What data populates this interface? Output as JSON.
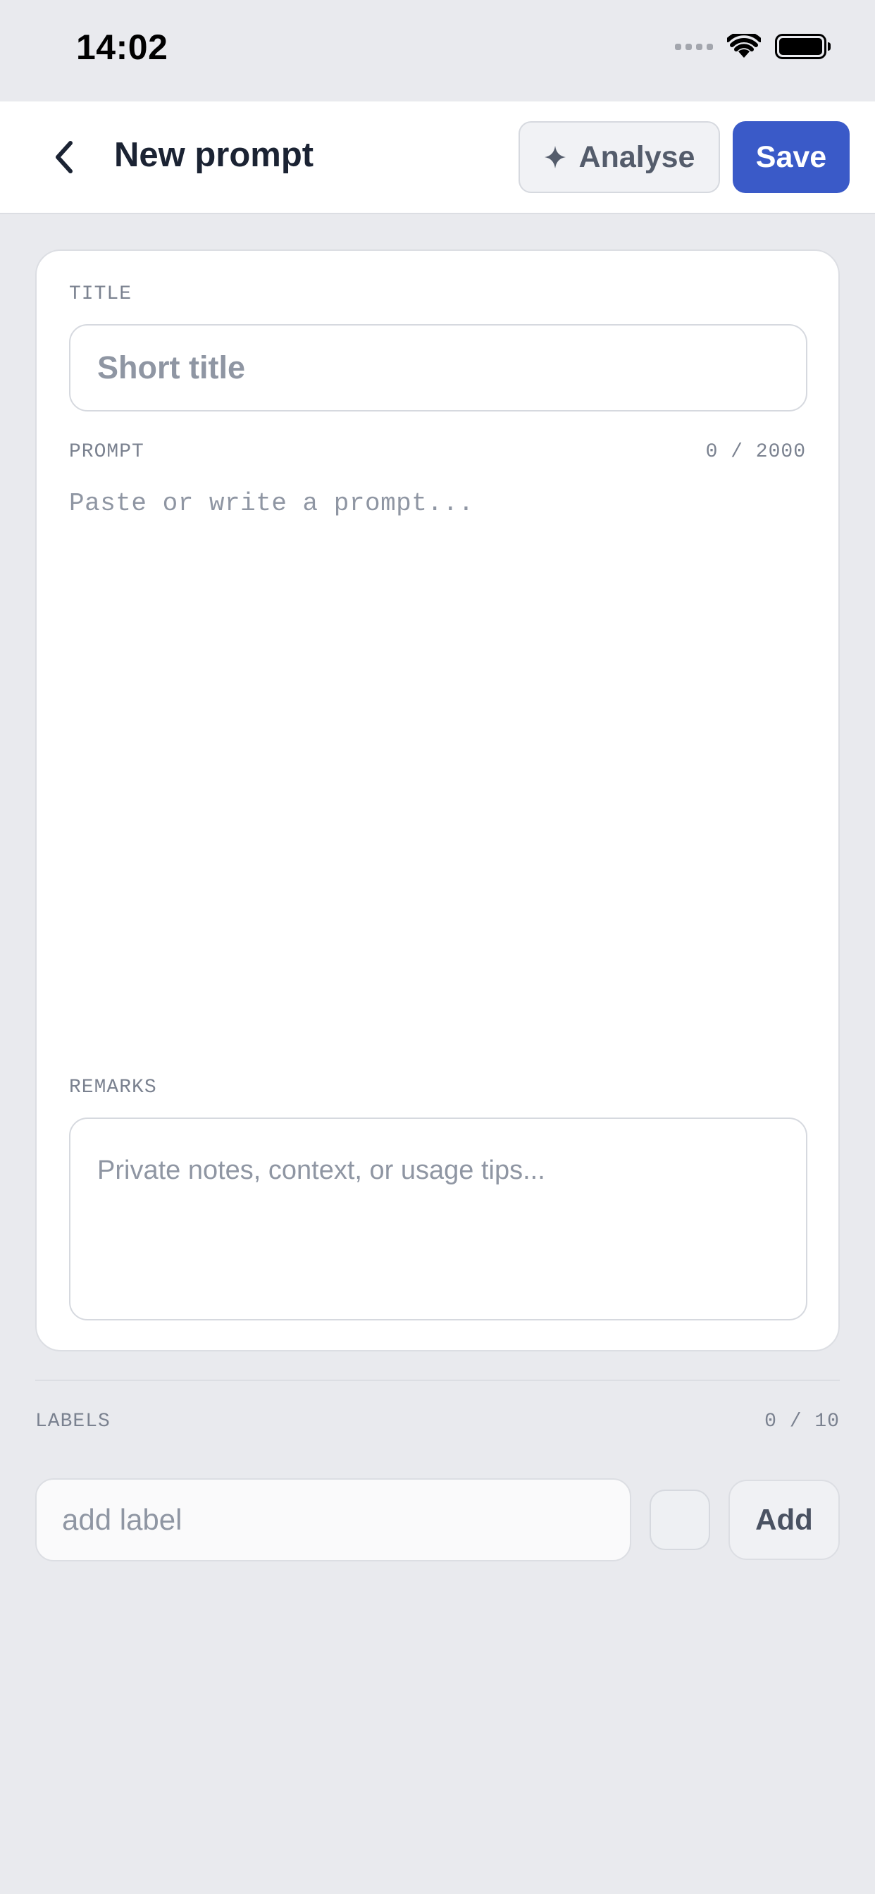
{
  "status_bar": {
    "time": "14:02"
  },
  "header": {
    "title": "New prompt",
    "analyse_label": "Analyse",
    "save_label": "Save"
  },
  "form": {
    "title_label": "TITLE",
    "title_placeholder": "Short title",
    "prompt_label": "PROMPT",
    "prompt_counter": "0 / 2000",
    "prompt_placeholder": "Paste or write a prompt...",
    "remarks_label": "REMARKS",
    "remarks_placeholder": "Private notes, context, or usage tips..."
  },
  "labels": {
    "section_label": "LABELS",
    "counter": "0 / 10",
    "input_placeholder": "add label",
    "add_label": "Add"
  },
  "icons": {
    "back": "chevron-left-icon",
    "analyse": "sparkle-icon",
    "wifi": "wifi-icon",
    "battery": "battery-icon",
    "signal": "cellular-signal-icon"
  },
  "colors": {
    "accent": "#3a5ac8",
    "background": "#e9eaee",
    "surface": "#ffffff",
    "text_primary": "#1b2333",
    "text_muted": "#8f96a3"
  }
}
